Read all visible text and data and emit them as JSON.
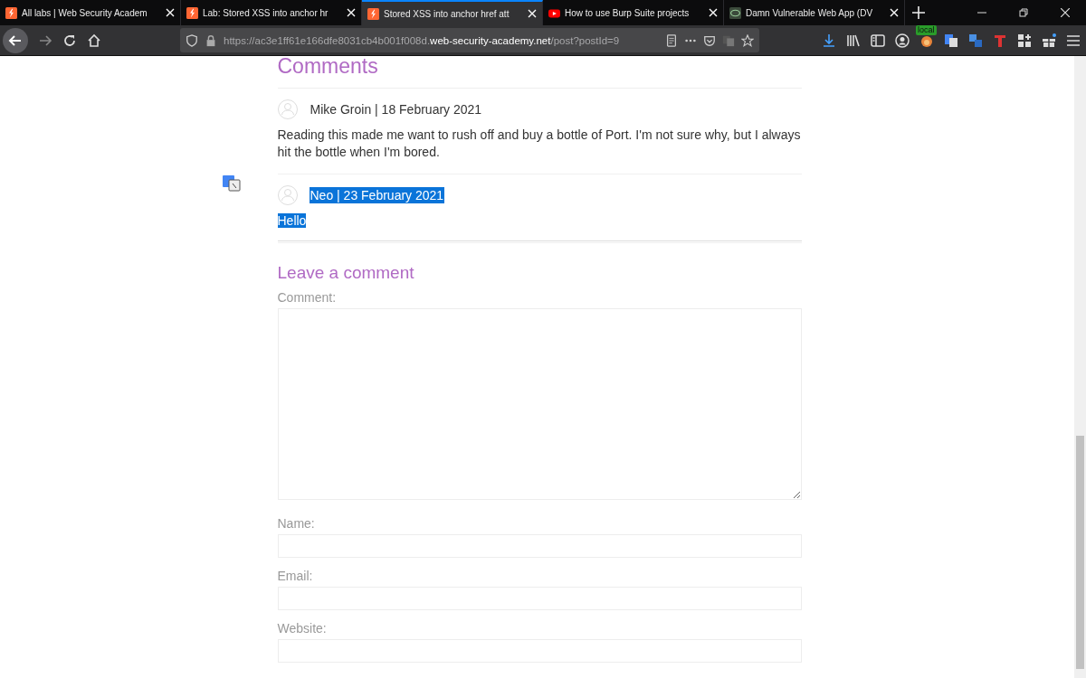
{
  "tabs": [
    {
      "title": "All labs | Web Security Academ",
      "kind": "lab",
      "selected": false
    },
    {
      "title": "Lab: Stored XSS into anchor hr",
      "kind": "lab",
      "selected": false
    },
    {
      "title": "Stored XSS into anchor href att",
      "kind": "lab",
      "selected": true
    },
    {
      "title": "How to use Burp Suite projects",
      "kind": "video",
      "selected": false
    },
    {
      "title": "Damn Vulnerable Web App (DV",
      "kind": "dvwa",
      "selected": false
    }
  ],
  "toolbar": {
    "url": {
      "prefix": "https://ac3e1ff61e166dfe8031cb4b001f008d.",
      "domain": "web-security-academy.net",
      "path": "/post?postId=9"
    },
    "extension_badge": "local"
  },
  "page": {
    "comments_heading": "Comments",
    "comments": [
      {
        "author_line": "Mike Groin | 18 February 2021",
        "body": "Reading this made me want to rush off and buy a bottle of Port. I'm not sure why, but I always hit the bottle when I'm bored.",
        "highlighted": false
      },
      {
        "author_line": "Neo | 23 February 2021",
        "body": "Hello",
        "highlighted": true
      }
    ],
    "form_heading": "Leave a comment",
    "fields": [
      {
        "label": "Comment:",
        "kind": "textarea"
      },
      {
        "label": "Name:",
        "kind": "input"
      },
      {
        "label": "Email:",
        "kind": "input"
      },
      {
        "label": "Website:",
        "kind": "input"
      }
    ]
  }
}
